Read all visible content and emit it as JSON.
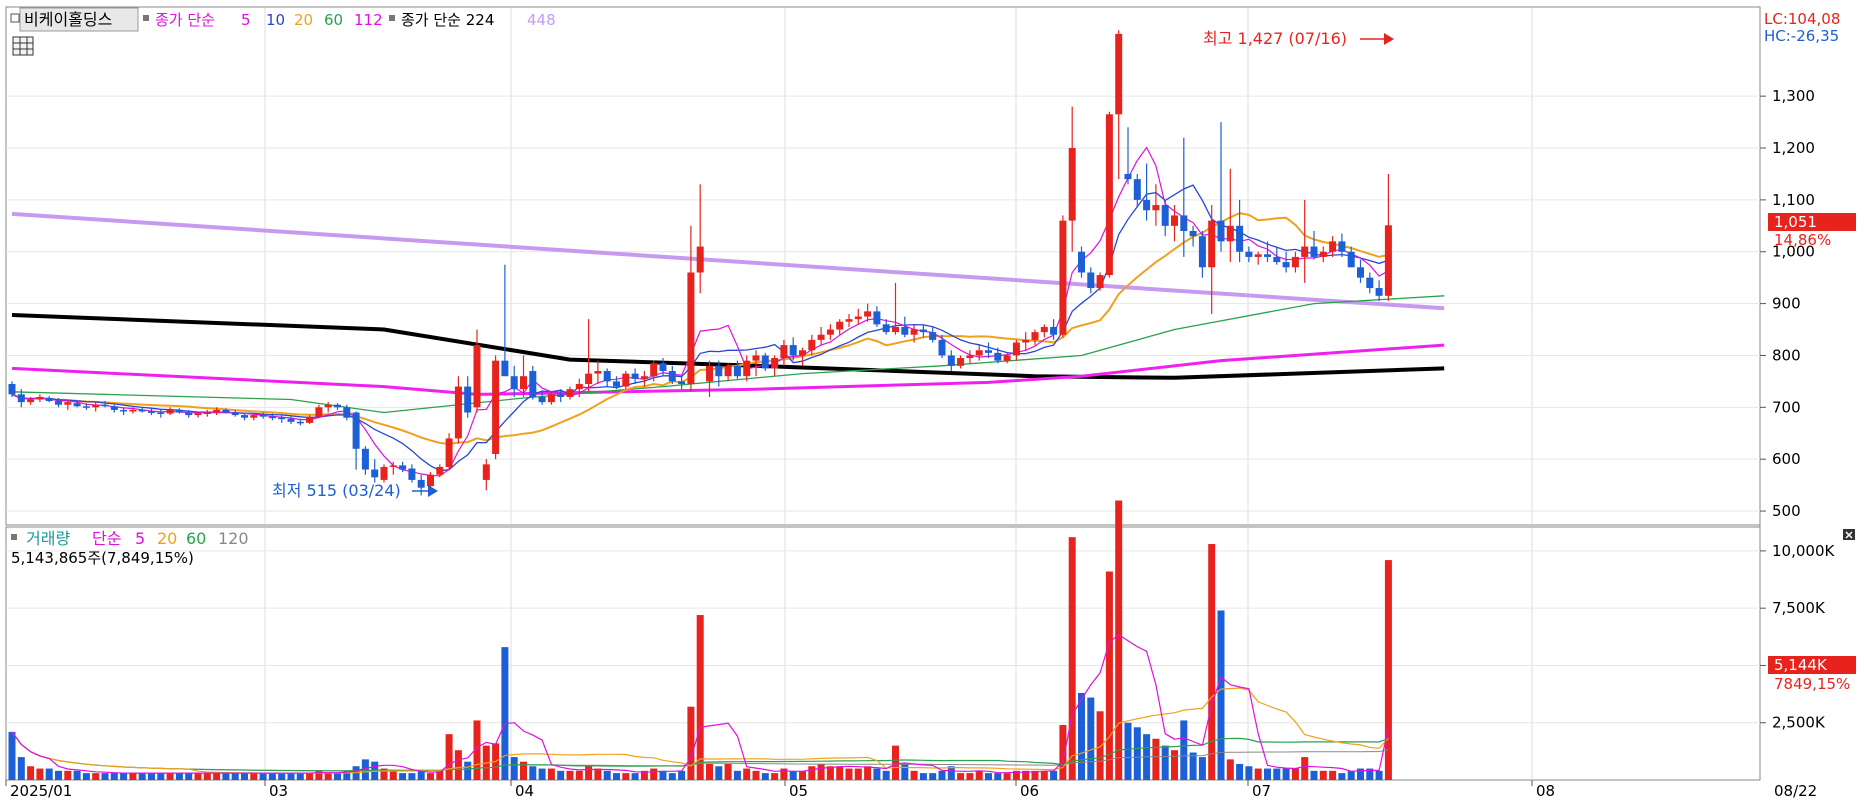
{
  "header": {
    "stock_name": "비케이홀딩스",
    "price_legend_prefix": "종가 단순",
    "ma_periods": [
      "5",
      "10",
      "20",
      "60",
      "112"
    ],
    "long_ma_label": "종가 단순 224",
    "long_ma_2": "448",
    "grid_icon": "grid-icon"
  },
  "volume_header": {
    "title": "거래량",
    "prefix": "단순",
    "ma_periods": [
      "5",
      "20",
      "60",
      "120"
    ],
    "current_volume": "5,143,865주(7,849,15%)"
  },
  "right_info": {
    "lc": "LC:104,08",
    "hc": "HC:-26,35",
    "price_badge": "1,051",
    "price_change": "14,86%",
    "volume_badge": "5,144K",
    "volume_change": "7849,15%"
  },
  "annotations": {
    "high": "최고 1,427 (07/16)",
    "low": "최저 515 (03/24)"
  },
  "colors": {
    "up": "#e8231e",
    "down": "#1c5fd6",
    "ma5": "#e010e0",
    "ma10": "#2846d6",
    "ma20": "#f0a11c",
    "ma60": "#2aa24a",
    "ma112": "#f020f0",
    "ma224": "#000000",
    "ma448": "#c79af0",
    "vol_ma120": "#888888"
  },
  "chart_data": [
    {
      "type": "candlestick",
      "title": "비케이홀딩스",
      "x_tick_labels": [
        "2025/01",
        "03",
        "04",
        "05",
        "06",
        "07",
        "08"
      ],
      "x_end_label": "08/22",
      "y_ticks": [
        "1,300",
        "1,200",
        "1,100",
        "1,000",
        "900",
        "800",
        "700",
        "600",
        "500"
      ],
      "ylim": [
        475,
        1470
      ],
      "high": {
        "value": 1427,
        "date": "07/16"
      },
      "low": {
        "value": 515,
        "date": "03/24"
      },
      "last_close": 1051,
      "change_pct": 14.86,
      "candles": [
        [
          745,
          750,
          720,
          725
        ],
        [
          725,
          735,
          700,
          710
        ],
        [
          710,
          720,
          705,
          715
        ],
        [
          715,
          725,
          710,
          720
        ],
        [
          718,
          722,
          710,
          712
        ],
        [
          712,
          718,
          700,
          705
        ],
        [
          705,
          715,
          695,
          710
        ],
        [
          708,
          712,
          700,
          702
        ],
        [
          702,
          708,
          695,
          700
        ],
        [
          700,
          710,
          692,
          705
        ],
        [
          705,
          712,
          700,
          702
        ],
        [
          702,
          705,
          690,
          695
        ],
        [
          695,
          700,
          685,
          692
        ],
        [
          692,
          700,
          688,
          695
        ],
        [
          695,
          700,
          690,
          692
        ],
        [
          692,
          698,
          685,
          690
        ],
        [
          690,
          695,
          680,
          688
        ],
        [
          688,
          700,
          685,
          695
        ],
        [
          695,
          698,
          688,
          690
        ],
        [
          690,
          695,
          680,
          685
        ],
        [
          685,
          692,
          680,
          688
        ],
        [
          688,
          695,
          682,
          690
        ],
        [
          690,
          700,
          685,
          695
        ],
        [
          695,
          698,
          688,
          690
        ],
        [
          690,
          695,
          682,
          685
        ],
        [
          685,
          690,
          675,
          680
        ],
        [
          680,
          688,
          675,
          685
        ],
        [
          685,
          690,
          678,
          682
        ],
        [
          682,
          688,
          675,
          680
        ],
        [
          680,
          685,
          670,
          678
        ],
        [
          678,
          682,
          668,
          672
        ],
        [
          672,
          678,
          665,
          670
        ],
        [
          670,
          685,
          668,
          682
        ],
        [
          682,
          705,
          680,
          700
        ],
        [
          700,
          710,
          690,
          705
        ],
        [
          705,
          708,
          695,
          700
        ],
        [
          700,
          705,
          675,
          680
        ],
        [
          690,
          692,
          580,
          620
        ],
        [
          620,
          625,
          570,
          580
        ],
        [
          580,
          600,
          555,
          565
        ],
        [
          560,
          590,
          555,
          585
        ],
        [
          585,
          595,
          570,
          588
        ],
        [
          588,
          595,
          575,
          580
        ],
        [
          582,
          590,
          555,
          560
        ],
        [
          560,
          570,
          530,
          545
        ],
        [
          548,
          575,
          545,
          570
        ],
        [
          570,
          590,
          565,
          585
        ],
        [
          585,
          650,
          580,
          640
        ],
        [
          640,
          760,
          630,
          740
        ],
        [
          740,
          760,
          680,
          690
        ],
        [
          700,
          850,
          690,
          820
        ],
        [
          560,
          600,
          540,
          590
        ],
        [
          610,
          800,
          600,
          790
        ],
        [
          790,
          975,
          760,
          760
        ],
        [
          760,
          780,
          720,
          735
        ],
        [
          735,
          800,
          720,
          760
        ],
        [
          770,
          780,
          715,
          720
        ],
        [
          720,
          730,
          705,
          710
        ],
        [
          710,
          730,
          705,
          725
        ],
        [
          725,
          735,
          710,
          720
        ],
        [
          720,
          740,
          715,
          735
        ],
        [
          735,
          755,
          720,
          745
        ],
        [
          745,
          870,
          730,
          765
        ],
        [
          765,
          790,
          745,
          770
        ],
        [
          770,
          775,
          740,
          750
        ],
        [
          750,
          760,
          735,
          740
        ],
        [
          740,
          770,
          735,
          765
        ],
        [
          765,
          775,
          745,
          755
        ],
        [
          755,
          770,
          740,
          760
        ],
        [
          760,
          790,
          750,
          785
        ],
        [
          785,
          795,
          760,
          770
        ],
        [
          770,
          780,
          745,
          750
        ],
        [
          750,
          760,
          735,
          745
        ],
        [
          745,
          1050,
          730,
          960
        ],
        [
          960,
          1130,
          920,
          1010
        ],
        [
          750,
          790,
          720,
          780
        ],
        [
          780,
          790,
          740,
          760
        ],
        [
          760,
          785,
          750,
          780
        ],
        [
          780,
          790,
          755,
          760
        ],
        [
          760,
          800,
          750,
          790
        ],
        [
          790,
          810,
          760,
          800
        ],
        [
          800,
          805,
          770,
          775
        ],
        [
          775,
          800,
          760,
          795
        ],
        [
          795,
          830,
          780,
          820
        ],
        [
          820,
          835,
          790,
          800
        ],
        [
          800,
          815,
          780,
          810
        ],
        [
          810,
          840,
          800,
          830
        ],
        [
          830,
          855,
          820,
          840
        ],
        [
          840,
          860,
          830,
          850
        ],
        [
          850,
          870,
          840,
          865
        ],
        [
          865,
          880,
          855,
          870
        ],
        [
          870,
          890,
          860,
          875
        ],
        [
          875,
          900,
          865,
          885
        ],
        [
          885,
          895,
          855,
          860
        ],
        [
          860,
          870,
          840,
          845
        ],
        [
          845,
          940,
          840,
          855
        ],
        [
          855,
          875,
          835,
          840
        ],
        [
          840,
          860,
          825,
          850
        ],
        [
          850,
          860,
          835,
          845
        ],
        [
          845,
          855,
          825,
          830
        ],
        [
          830,
          840,
          795,
          800
        ],
        [
          800,
          810,
          770,
          780
        ],
        [
          780,
          800,
          775,
          795
        ],
        [
          795,
          810,
          785,
          800
        ],
        [
          800,
          820,
          790,
          810
        ],
        [
          810,
          825,
          795,
          805
        ],
        [
          805,
          815,
          785,
          790
        ],
        [
          790,
          805,
          785,
          800
        ],
        [
          800,
          830,
          790,
          825
        ],
        [
          825,
          845,
          810,
          830
        ],
        [
          830,
          850,
          820,
          845
        ],
        [
          845,
          860,
          835,
          855
        ],
        [
          855,
          870,
          830,
          840
        ],
        [
          840,
          1070,
          835,
          1060
        ],
        [
          1060,
          1280,
          1000,
          1200
        ],
        [
          1000,
          1010,
          950,
          960
        ],
        [
          960,
          970,
          920,
          930
        ],
        [
          930,
          960,
          925,
          955
        ],
        [
          955,
          1270,
          950,
          1265
        ],
        [
          1265,
          1427,
          1140,
          1420
        ],
        [
          1150,
          1240,
          1130,
          1140
        ],
        [
          1140,
          1150,
          1085,
          1100
        ],
        [
          1100,
          1170,
          1060,
          1080
        ],
        [
          1080,
          1130,
          1050,
          1090
        ],
        [
          1090,
          1100,
          1030,
          1050
        ],
        [
          1050,
          1090,
          1020,
          1070
        ],
        [
          1070,
          1220,
          990,
          1040
        ],
        [
          1040,
          1050,
          1010,
          1030
        ],
        [
          1030,
          1040,
          950,
          970
        ],
        [
          970,
          1090,
          880,
          1060
        ],
        [
          1060,
          1250,
          1000,
          1020
        ],
        [
          1020,
          1160,
          980,
          1050
        ],
        [
          1050,
          1100,
          980,
          1000
        ],
        [
          1000,
          1010,
          980,
          990
        ],
        [
          990,
          1000,
          975,
          995
        ],
        [
          995,
          1020,
          980,
          990
        ],
        [
          990,
          1010,
          975,
          980
        ],
        [
          980,
          1000,
          960,
          970
        ],
        [
          970,
          1000,
          960,
          990
        ],
        [
          990,
          1100,
          940,
          1010
        ],
        [
          1010,
          1040,
          985,
          990
        ],
        [
          990,
          1010,
          980,
          1000
        ],
        [
          1000,
          1030,
          990,
          1020
        ],
        [
          1020,
          1035,
          990,
          1000
        ],
        [
          1000,
          1010,
          970,
          970
        ],
        [
          970,
          985,
          940,
          950
        ],
        [
          950,
          960,
          920,
          930
        ],
        [
          930,
          945,
          905,
          915
        ],
        [
          915,
          1150,
          905,
          1051
        ]
      ],
      "volumes": [
        2.1,
        1.0,
        0.6,
        0.5,
        0.5,
        0.4,
        0.4,
        0.4,
        0.3,
        0.3,
        0.3,
        0.3,
        0.3,
        0.3,
        0.3,
        0.3,
        0.3,
        0.3,
        0.3,
        0.3,
        0.3,
        0.3,
        0.3,
        0.3,
        0.3,
        0.3,
        0.3,
        0.3,
        0.3,
        0.3,
        0.3,
        0.3,
        0.3,
        0.4,
        0.3,
        0.3,
        0.4,
        0.6,
        0.9,
        0.8,
        0.5,
        0.4,
        0.3,
        0.3,
        0.4,
        0.3,
        0.4,
        2.0,
        1.3,
        0.8,
        2.6,
        1.5,
        1.6,
        5.8,
        1.0,
        0.8,
        0.6,
        0.5,
        0.5,
        0.4,
        0.4,
        0.4,
        0.6,
        0.5,
        0.4,
        0.3,
        0.3,
        0.3,
        0.4,
        0.5,
        0.4,
        0.3,
        0.4,
        3.2,
        7.2,
        0.7,
        0.6,
        0.7,
        0.4,
        0.5,
        0.4,
        0.3,
        0.3,
        0.5,
        0.4,
        0.4,
        0.6,
        0.7,
        0.6,
        0.6,
        0.5,
        0.5,
        0.6,
        0.5,
        0.4,
        1.5,
        0.7,
        0.4,
        0.3,
        0.3,
        0.4,
        0.6,
        0.3,
        0.3,
        0.4,
        0.3,
        0.3,
        0.3,
        0.4,
        0.4,
        0.4,
        0.4,
        0.4,
        2.4,
        10.6,
        3.8,
        3.6,
        3.0,
        9.1,
        12.2,
        2.5,
        2.3,
        2.0,
        1.8,
        1.5,
        1.3,
        2.6,
        1.2,
        1.0,
        10.3,
        7.4,
        0.9,
        0.7,
        0.6,
        0.5,
        0.5,
        0.5,
        0.5,
        0.5,
        1.0,
        0.4,
        0.4,
        0.4,
        0.3,
        0.4,
        0.5,
        0.5,
        0.4,
        9.6
      ],
      "moving_averages": {
        "ma448": [
          [
            0,
            1073
          ],
          [
            154,
            891
          ]
        ],
        "ma224": [
          [
            0,
            878
          ],
          [
            40,
            850
          ],
          [
            60,
            792
          ],
          [
            80,
            780
          ],
          [
            110,
            760
          ],
          [
            125,
            757
          ],
          [
            154,
            775
          ]
        ],
        "ma112": [
          [
            0,
            775
          ],
          [
            40,
            740
          ],
          [
            50,
            725
          ],
          [
            60,
            728
          ],
          [
            80,
            735
          ],
          [
            105,
            748
          ],
          [
            115,
            760
          ],
          [
            130,
            790
          ],
          [
            154,
            820
          ]
        ],
        "ma60": [
          [
            0,
            730
          ],
          [
            30,
            715
          ],
          [
            40,
            690
          ],
          [
            55,
            718
          ],
          [
            70,
            740
          ],
          [
            85,
            765
          ],
          [
            100,
            780
          ],
          [
            115,
            800
          ],
          [
            125,
            850
          ],
          [
            140,
            900
          ],
          [
            154,
            915
          ]
        ]
      }
    },
    {
      "type": "bar",
      "title": "거래량",
      "y_ticks": [
        "10,000K",
        "7,500K",
        "5,000K",
        "2,500K"
      ],
      "ylim": [
        0,
        11000
      ],
      "unit": "K",
      "last_volume": 5143865,
      "last_volume_change_pct": 7849.15
    }
  ]
}
